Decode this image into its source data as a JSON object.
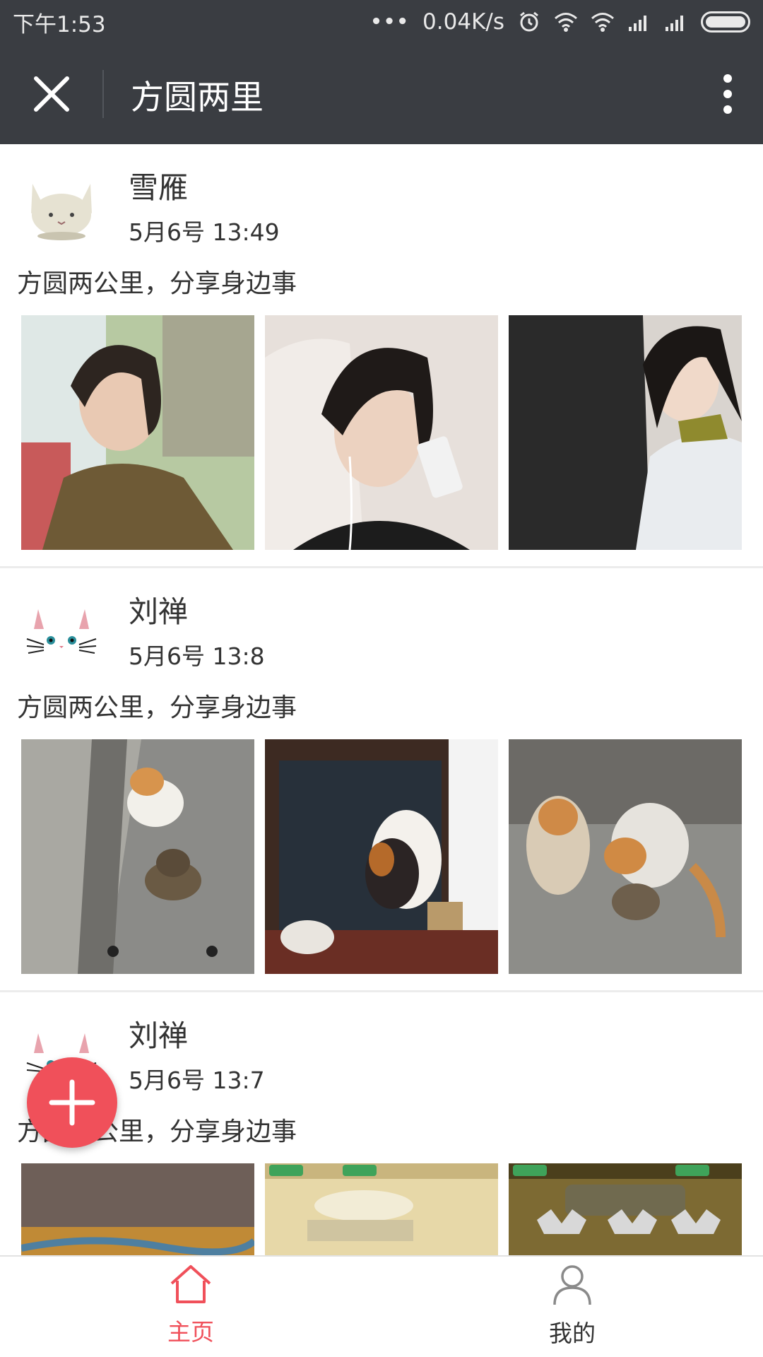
{
  "status_bar": {
    "time": "下午1:53",
    "dots": "•••",
    "speed": "0.04K/s",
    "icons": [
      "alarm-icon",
      "wifi-hd-icon",
      "wifi-icon",
      "signal-icon",
      "signal-icon",
      "battery-icon"
    ]
  },
  "nav": {
    "title": "方圆两里",
    "close_icon": "close-icon",
    "more_icon": "more-vertical-icon"
  },
  "posts": [
    {
      "username": "雪雁",
      "time": "5月6号 13:49",
      "caption": "方圆两公里，分享身边事",
      "avatar": "cat-face-avatar",
      "photos": [
        "girl-in-car-photo",
        "girl-with-earphones-photo",
        "two-girls-selfie-photo"
      ]
    },
    {
      "username": "刘禅",
      "time": "5月6号 13:8",
      "caption": "方圆两公里，分享身边事",
      "avatar": "white-cat-avatar",
      "photos": [
        "cats-on-curb-photo",
        "cat-at-window-photo",
        "cat-group-photo"
      ]
    },
    {
      "username": "刘禅",
      "time": "5月6号 13:7",
      "caption": "方圆两公里，分享身边事",
      "avatar": "white-cat-avatar",
      "photos": [
        "savanna-game-photo",
        "piano-game-photo",
        "grassland-game-photo"
      ]
    }
  ],
  "fab": {
    "icon": "plus-icon"
  },
  "tabs": [
    {
      "label": "主页",
      "icon": "home-icon",
      "active": true
    },
    {
      "label": "我的",
      "icon": "person-icon",
      "active": false
    }
  ],
  "colors": {
    "header_bg": "#3a3d42",
    "accent": "#f0505a"
  }
}
